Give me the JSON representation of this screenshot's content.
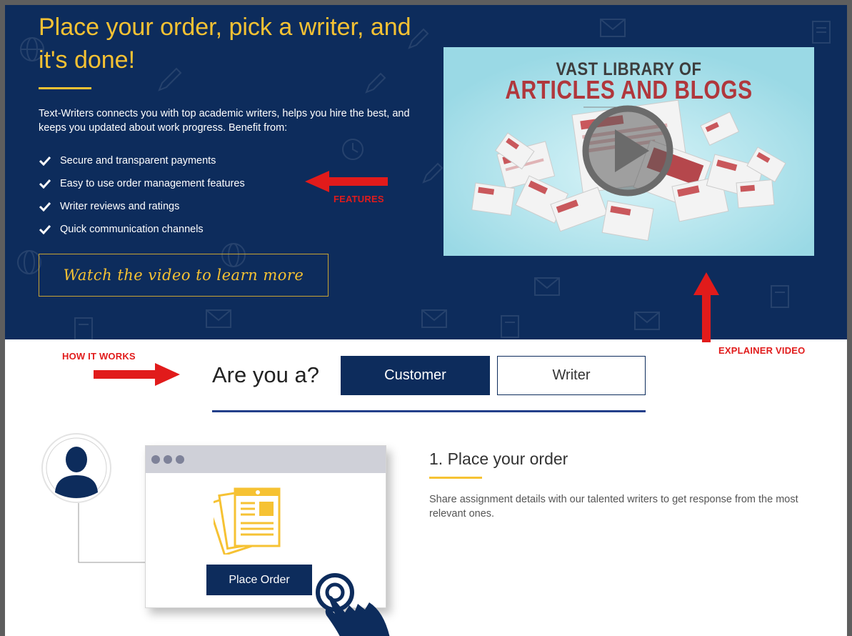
{
  "hero": {
    "title": "Place your order, pick a writer, and it's done!",
    "description": "Text-Writers connects you with top academic writers, helps you hire the best, and keeps you updated about work progress. Benefit from:",
    "features": [
      "Secure and transparent payments",
      "Easy to use order management features",
      "Writer reviews and ratings",
      "Quick communication channels"
    ],
    "watch_button": "Watch the video to learn more",
    "accent_color": "#f6c233",
    "background_color": "#0d2c5c"
  },
  "video": {
    "title_line1": "VAST LIBRARY OF",
    "title_line2": "ARTICLES AND BLOGS",
    "play_icon": "play-icon"
  },
  "annotations": {
    "features": "FEATURES",
    "how_it_works": "HOW IT WORKS",
    "explainer_video": "EXPLAINER VIDEO",
    "color": "#e11b1b"
  },
  "how_it_works": {
    "question": "Are you a?",
    "tabs": [
      "Customer",
      "Writer"
    ],
    "active_tab": "Customer"
  },
  "step": {
    "title": "1. Place your order",
    "description": "Share assignment details with our talented writers to get response from the most relevant ones.",
    "button": "Place Order"
  }
}
